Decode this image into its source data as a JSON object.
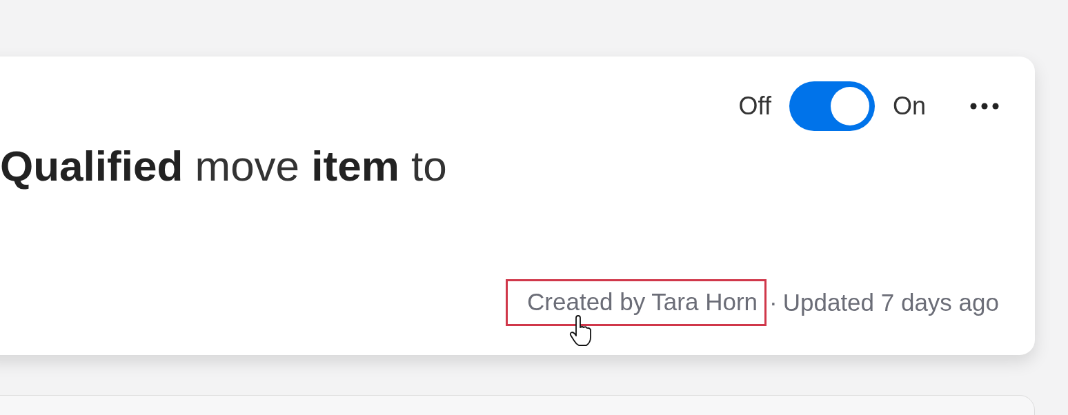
{
  "automation": {
    "title": "**Qualified** move **item** to",
    "toggle": {
      "off_label": "Off",
      "on_label": "On",
      "on": true
    },
    "creator": "Created by Tara Horn",
    "creator_highlighted": true,
    "separator": "·",
    "updated": "Updated 7 days ago"
  }
}
